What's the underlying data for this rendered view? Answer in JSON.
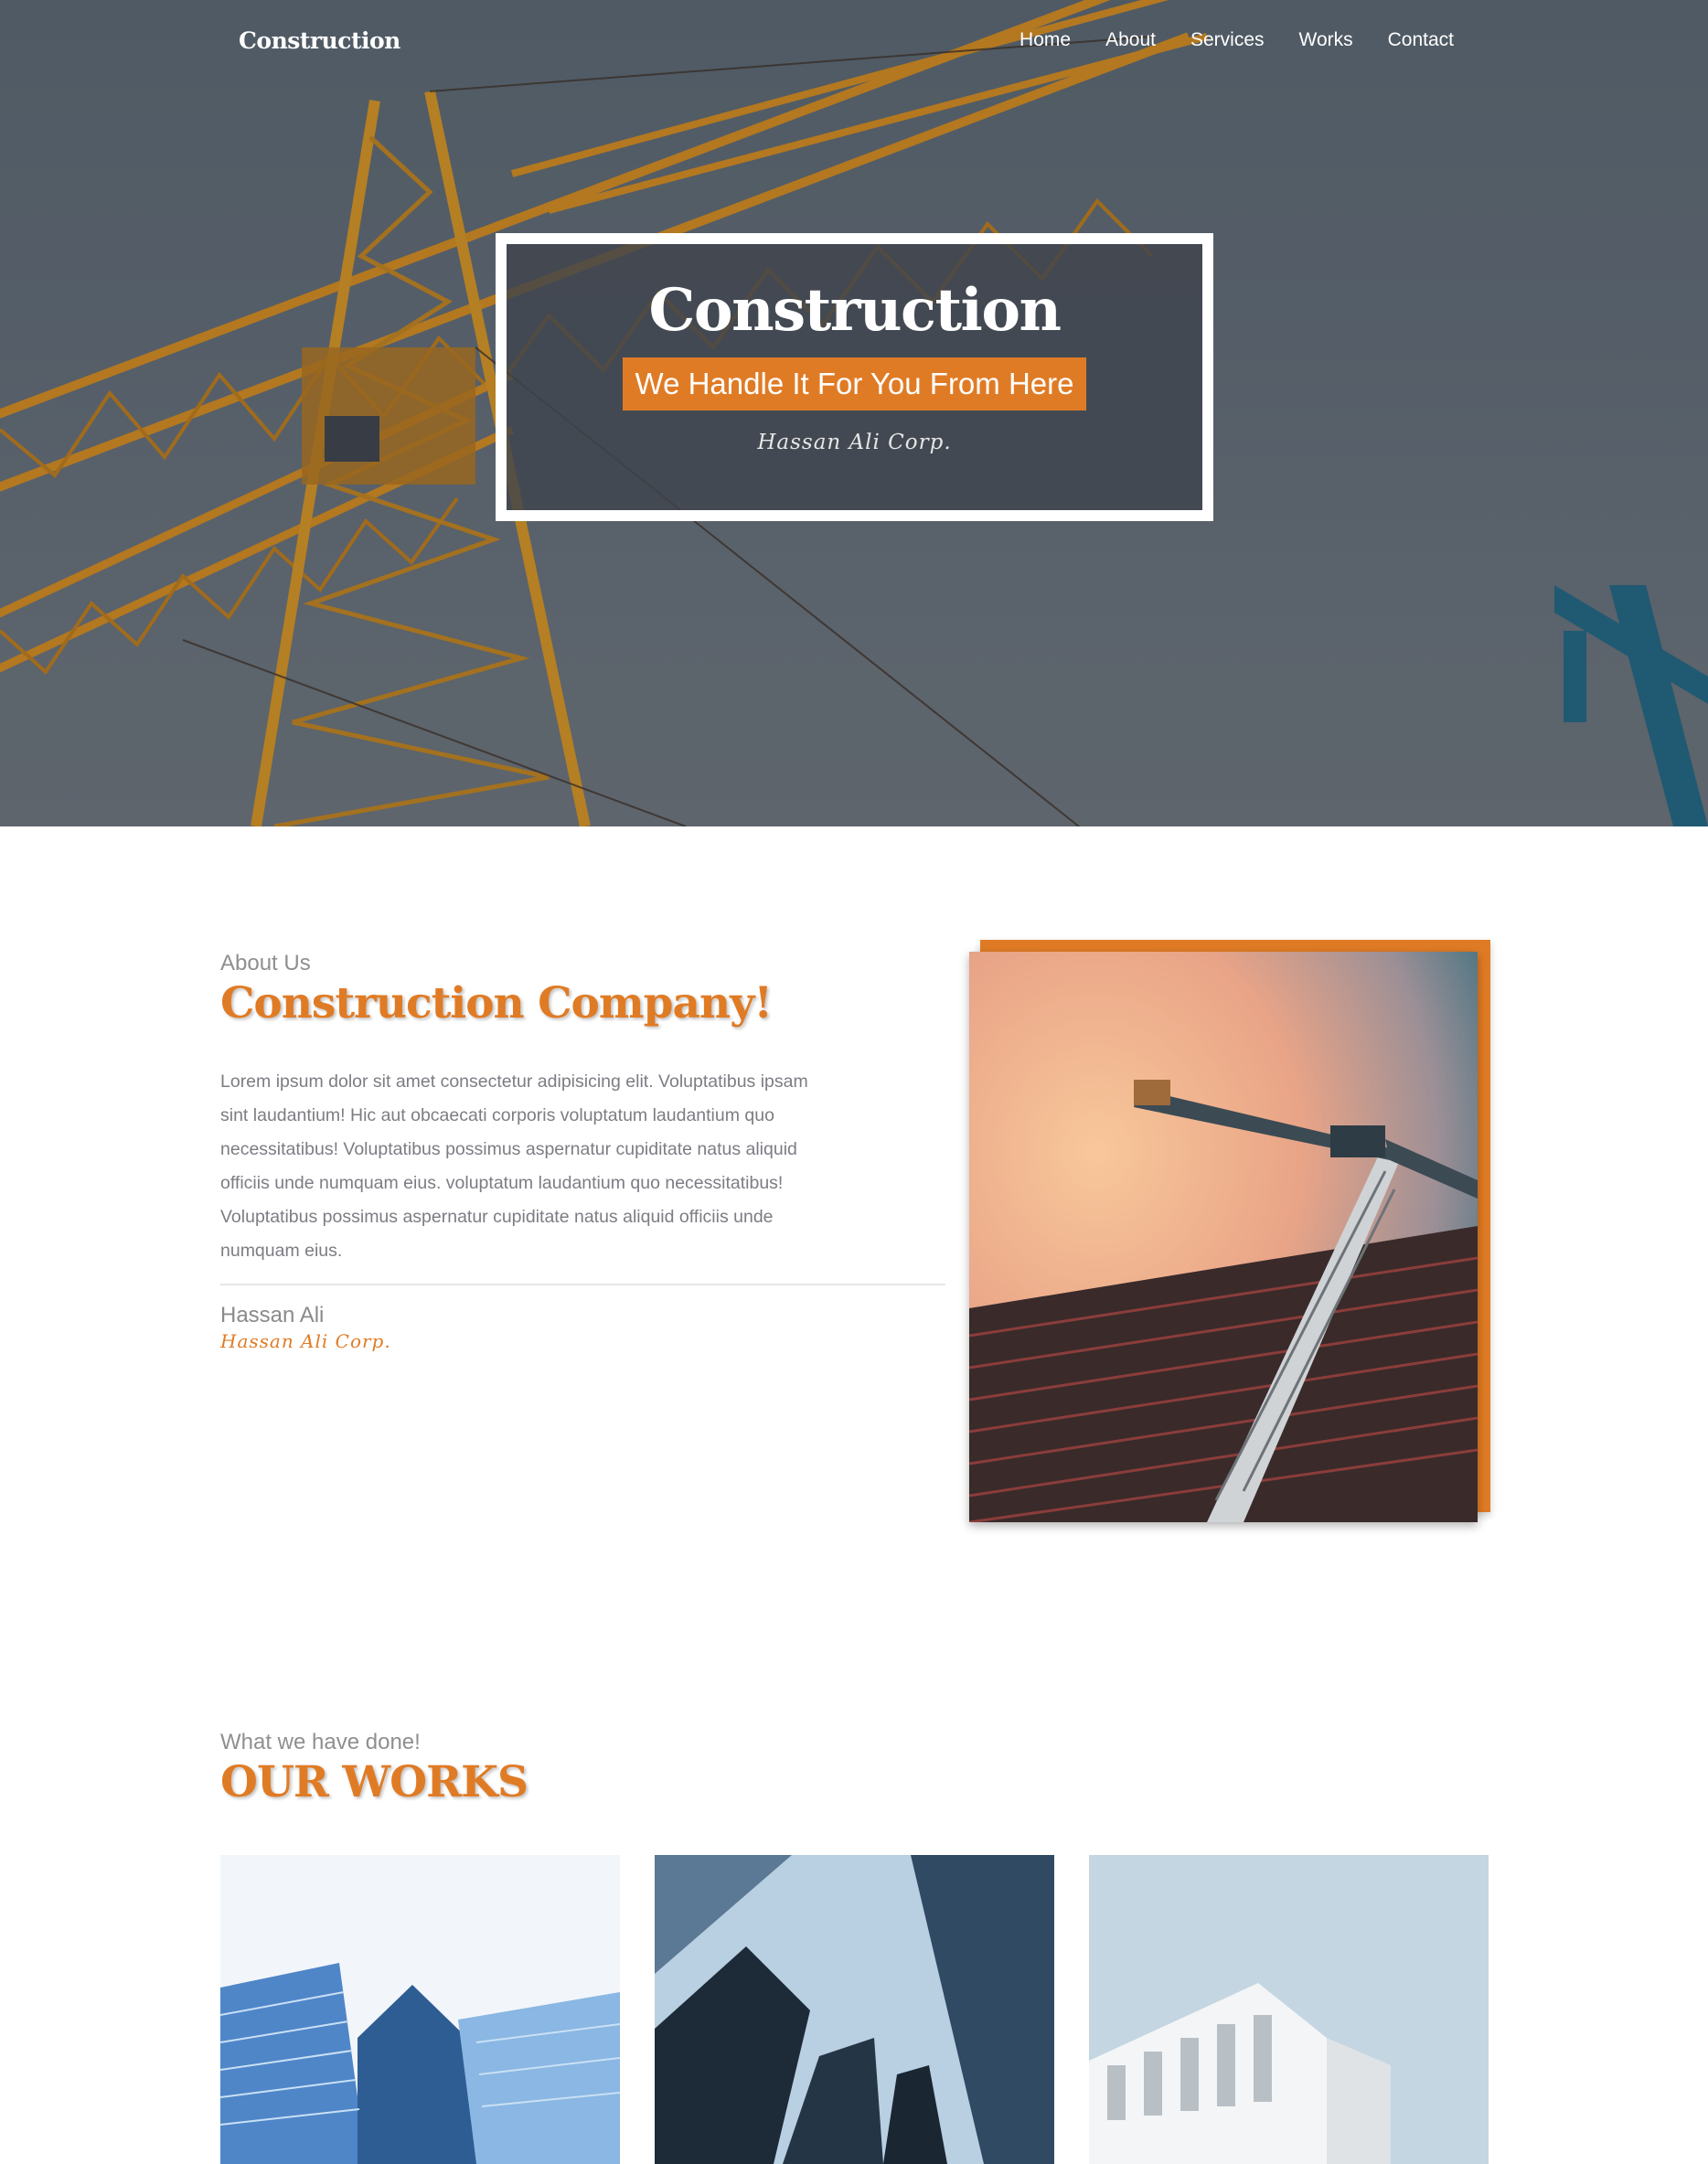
{
  "nav": {
    "brand": "Construction",
    "links": [
      "Home",
      "About",
      "Services",
      "Works",
      "Contact"
    ]
  },
  "hero": {
    "title": "Construction",
    "tagline": "We Handle It For You From Here",
    "signature": "Hassan Ali Corp."
  },
  "about": {
    "eyebrow": "About Us",
    "heading": "Construction Company!",
    "body": "Lorem ipsum dolor sit amet consectetur adipisicing elit. Voluptatibus ipsam sint laudantium! Hic aut obcaecati corporis voluptatum laudantium quo necessitatibus! Voluptatibus possimus aspernatur cupiditate natus aliquid officiis unde numquam eius. voluptatum laudantium quo necessitatibus! Voluptatibus possimus aspernatur cupiditate natus aliquid officiis unde numquam eius.",
    "author_name": "Hassan Ali",
    "author_corp": "Hassan Ali Corp."
  },
  "works": {
    "eyebrow": "What we have done!",
    "heading": "OUR WORKS"
  },
  "colors": {
    "accent": "#e07b25",
    "hero_sky": "#5d6771",
    "text_muted": "#7c7c84"
  }
}
